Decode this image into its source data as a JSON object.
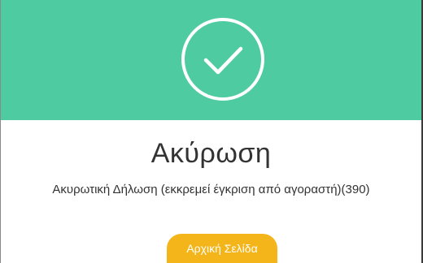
{
  "header": {
    "background_color": "#4ecba1",
    "icon": "check-circle-icon"
  },
  "main": {
    "title": "Ακύρωση",
    "message": "Ακυρωτική Δήλωση (εκκρεμεί έγκριση από αγοραστή)(390)"
  },
  "actions": {
    "home_label": "Αρχική Σελίδα",
    "home_color": "#f3b519"
  }
}
